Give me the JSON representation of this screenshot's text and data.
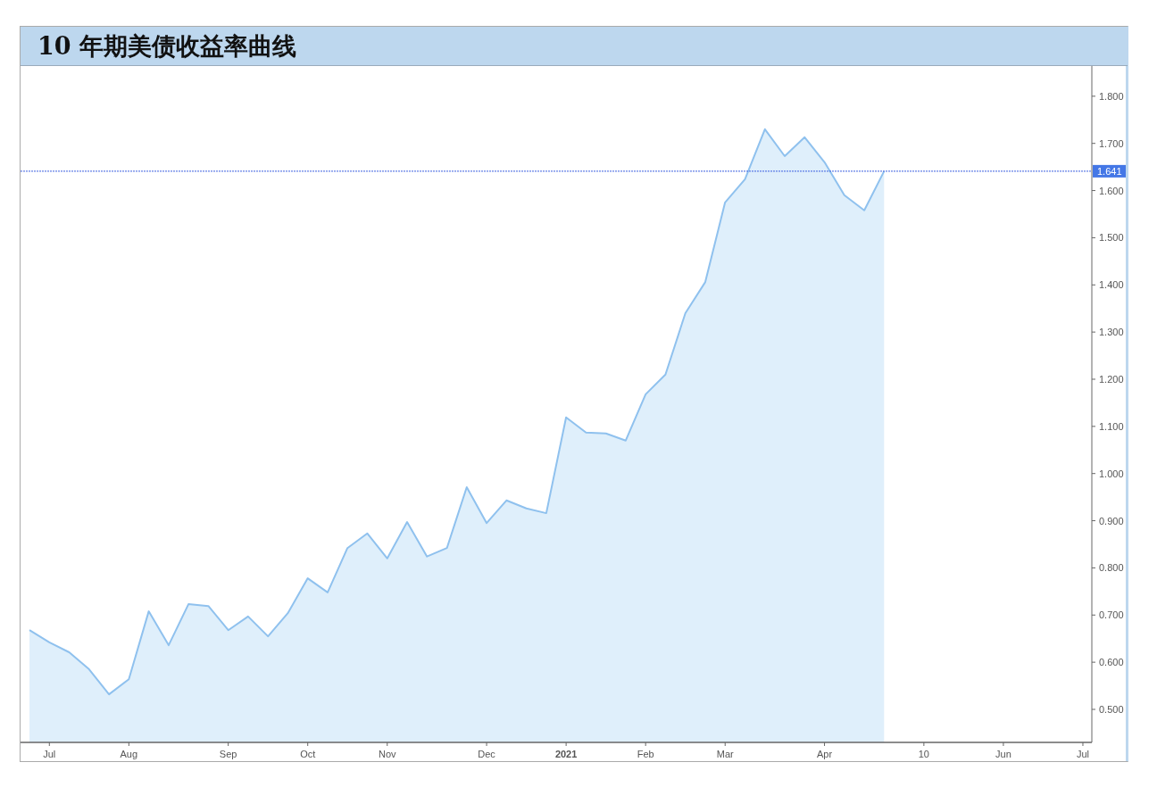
{
  "title": "10 年期美债收益率曲线",
  "chart_data": {
    "type": "area",
    "categories": [
      null,
      "Jul",
      null,
      null,
      null,
      "Aug",
      null,
      null,
      null,
      null,
      "Sep",
      null,
      null,
      null,
      "Oct",
      null,
      null,
      null,
      "Nov",
      null,
      null,
      null,
      null,
      "Dec",
      null,
      null,
      null,
      "2021",
      null,
      null,
      null,
      "Feb",
      null,
      null,
      null,
      "Mar",
      null,
      null,
      null,
      null,
      "Apr",
      null,
      null,
      null,
      null,
      "10",
      null,
      null,
      null,
      "Jun",
      null,
      null,
      null,
      "Jul"
    ],
    "series": [
      {
        "color": "#8fc1ee",
        "values": [
          0.668,
          0.642,
          0.621,
          0.585,
          0.532,
          0.564,
          0.708,
          0.636,
          0.723,
          0.719,
          0.668,
          0.697,
          0.655,
          0.704,
          0.778,
          0.748,
          0.842,
          0.873,
          0.82,
          0.897,
          0.824,
          0.842,
          0.971,
          0.895,
          0.943,
          0.926,
          0.916,
          1.119,
          1.087,
          1.085,
          1.07,
          1.168,
          1.21,
          1.34,
          1.406,
          1.575,
          1.624,
          1.73,
          1.673,
          1.713,
          1.66,
          1.59,
          1.558,
          1.641,
          null,
          null,
          null,
          null,
          null,
          null,
          null,
          null,
          null,
          null
        ]
      }
    ],
    "ylim": [
      0.43,
      1.864
    ],
    "yticks": [
      {
        "value": 0.5,
        "label": "0.500"
      },
      {
        "value": 0.6,
        "label": "0.600"
      },
      {
        "value": 0.7,
        "label": "0.700"
      },
      {
        "value": 0.8,
        "label": "0.800"
      },
      {
        "value": 0.9,
        "label": "0.900"
      },
      {
        "value": 1.0,
        "label": "1.000"
      },
      {
        "value": 1.1,
        "label": "1.100"
      },
      {
        "value": 1.2,
        "label": "1.200"
      },
      {
        "value": 1.3,
        "label": "1.300"
      },
      {
        "value": 1.4,
        "label": "1.400"
      },
      {
        "value": 1.5,
        "label": "1.500"
      },
      {
        "value": 1.6,
        "label": "1.600"
      },
      {
        "value": 1.7,
        "label": "1.700"
      },
      {
        "value": 1.8,
        "label": "1.800"
      }
    ],
    "ref_lines": [
      {
        "axis": "y",
        "value": 1.641,
        "label": "1.641"
      }
    ]
  }
}
